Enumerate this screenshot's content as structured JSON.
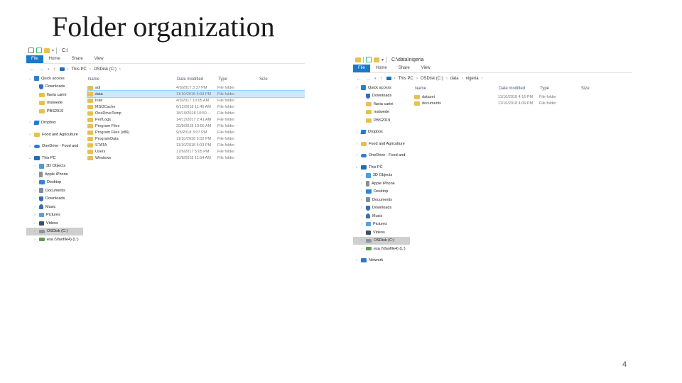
{
  "slide": {
    "title": "Folder organization",
    "page_number": "4"
  },
  "explorer1": {
    "window_title": "C:\\",
    "ribbon_tabs": [
      "File",
      "Home",
      "Share",
      "View"
    ],
    "breadcrumb": [
      "This PC",
      "OSDisk (C:)"
    ],
    "columns": [
      "Name",
      "Date modified",
      "Type",
      "Size"
    ],
    "files": [
      {
        "name": "adi",
        "date": "4/9/2017 3:37 PM",
        "type": "File folder",
        "selected": false
      },
      {
        "name": "data",
        "date": "11/10/2018 5:03 PM",
        "type": "File folder",
        "selected": true
      },
      {
        "name": "Intel",
        "date": "4/9/2017 10:05 AM",
        "type": "File folder",
        "selected": false
      },
      {
        "name": "MSOCache",
        "date": "6/12/2018 11:46 AM",
        "type": "File folder",
        "selected": false
      },
      {
        "name": "OneDriveTemp",
        "date": "18/10/2018 10:50 ...",
        "type": "File folder",
        "selected": false
      },
      {
        "name": "PerfLogs",
        "date": "14/12/2017 2:41 AM",
        "type": "File folder",
        "selected": false
      },
      {
        "name": "Program Files",
        "date": "20/9/2018 10:56 AM",
        "type": "File folder",
        "selected": false
      },
      {
        "name": "Program Files (x86)",
        "date": "9/5/2018 3:07 PM",
        "type": "File folder",
        "selected": false
      },
      {
        "name": "ProgramData",
        "date": "11/10/2018 5:02 PM",
        "type": "File folder",
        "selected": false
      },
      {
        "name": "STATA",
        "date": "11/10/2018 5:03 PM",
        "type": "File folder",
        "selected": false
      },
      {
        "name": "Users",
        "date": "17/6/2017 5:05 PM",
        "type": "File folder",
        "selected": false
      },
      {
        "name": "Windows",
        "date": "10/8/2018 11:54 AM",
        "type": "File folder",
        "selected": false
      }
    ],
    "nav": [
      {
        "label": "Quick access",
        "icon": "star-icon",
        "level": 0,
        "expander": "v",
        "gap": false,
        "selected": false
      },
      {
        "label": "Downloads",
        "icon": "download-icon",
        "level": 1,
        "expander": "",
        "gap": false,
        "selected": false
      },
      {
        "label": "flavia carini",
        "icon": "folder-icon",
        "level": 1,
        "expander": "",
        "gap": false,
        "selected": false
      },
      {
        "label": "mstwede",
        "icon": "folder-icon",
        "level": 1,
        "expander": "",
        "gap": false,
        "selected": false
      },
      {
        "label": "PBS2019",
        "icon": "folder-icon",
        "level": 1,
        "expander": "",
        "gap": false,
        "selected": false
      },
      {
        "label": "Dropbox",
        "icon": "dropbox-icon",
        "level": 0,
        "expander": ">",
        "gap": true,
        "selected": false
      },
      {
        "label": "Food and Agriculture",
        "icon": "folder-icon",
        "level": 0,
        "expander": ">",
        "gap": true,
        "selected": false
      },
      {
        "label": "OneDrive - Food and",
        "icon": "onedrive-icon",
        "level": 0,
        "expander": ">",
        "gap": true,
        "selected": false
      },
      {
        "label": "This PC",
        "icon": "pc-icon",
        "level": 0,
        "expander": "v",
        "gap": true,
        "selected": false
      },
      {
        "label": "3D Objects",
        "icon": "3d-objects-icon",
        "level": 1,
        "expander": ">",
        "gap": false,
        "selected": false
      },
      {
        "label": "Apple iPhone",
        "icon": "phone-icon",
        "level": 1,
        "expander": ">",
        "gap": false,
        "selected": false
      },
      {
        "label": "Desktop",
        "icon": "desktop-icon",
        "level": 1,
        "expander": ">",
        "gap": false,
        "selected": false
      },
      {
        "label": "Documents",
        "icon": "documents-icon",
        "level": 1,
        "expander": ">",
        "gap": false,
        "selected": false
      },
      {
        "label": "Downloads",
        "icon": "download-icon",
        "level": 1,
        "expander": ">",
        "gap": false,
        "selected": false
      },
      {
        "label": "Music",
        "icon": "music-icon",
        "level": 1,
        "expander": ">",
        "gap": false,
        "selected": false
      },
      {
        "label": "Pictures",
        "icon": "pictures-icon",
        "level": 1,
        "expander": ">",
        "gap": false,
        "selected": false
      },
      {
        "label": "Videos",
        "icon": "videos-icon",
        "level": 1,
        "expander": ">",
        "gap": false,
        "selected": false
      },
      {
        "label": "OSDisk (C:)",
        "icon": "drive-icon",
        "level": 1,
        "expander": ">",
        "gap": false,
        "selected": true
      },
      {
        "label": "esa (\\\\faofile4) (L:)",
        "icon": "usb-drive-icon",
        "level": 1,
        "expander": ">",
        "gap": false,
        "selected": false
      }
    ]
  },
  "explorer2": {
    "window_title": "C:\\data\\nigeria",
    "ribbon_tabs": [
      "File",
      "Home",
      "Share",
      "View"
    ],
    "breadcrumb": [
      "This PC",
      "OSDisk (C:)",
      "data",
      "nigeria"
    ],
    "columns": [
      "Name",
      "Date modified",
      "Type",
      "Size"
    ],
    "files": [
      {
        "name": "dataset",
        "date": "11/10/2018 4:16 PM",
        "type": "File folder",
        "selected": false
      },
      {
        "name": "documents",
        "date": "11/10/2018 4:06 PM",
        "type": "File folder",
        "selected": false
      }
    ],
    "nav": [
      {
        "label": "Quick access",
        "icon": "star-icon",
        "level": 0,
        "expander": ">",
        "gap": false,
        "selected": false
      },
      {
        "label": "Downloads",
        "icon": "download-icon",
        "level": 1,
        "expander": "",
        "gap": false,
        "selected": false
      },
      {
        "label": "flavia carini",
        "icon": "folder-icon",
        "level": 1,
        "expander": "",
        "gap": false,
        "selected": false
      },
      {
        "label": "mstwede",
        "icon": "folder-icon",
        "level": 1,
        "expander": "",
        "gap": false,
        "selected": false
      },
      {
        "label": "PBS2019",
        "icon": "folder-icon",
        "level": 1,
        "expander": "",
        "gap": false,
        "selected": false
      },
      {
        "label": "Dropbox",
        "icon": "dropbox-icon",
        "level": 0,
        "expander": ">",
        "gap": true,
        "selected": false
      },
      {
        "label": "Food and Agriculture",
        "icon": "folder-icon",
        "level": 0,
        "expander": ">",
        "gap": true,
        "selected": false
      },
      {
        "label": "OneDrive - Food and",
        "icon": "onedrive-icon",
        "level": 0,
        "expander": ">",
        "gap": true,
        "selected": false
      },
      {
        "label": "This PC",
        "icon": "pc-icon",
        "level": 0,
        "expander": "v",
        "gap": true,
        "selected": false
      },
      {
        "label": "3D Objects",
        "icon": "3d-objects-icon",
        "level": 1,
        "expander": ">",
        "gap": false,
        "selected": false
      },
      {
        "label": "Apple iPhone",
        "icon": "phone-icon",
        "level": 1,
        "expander": ">",
        "gap": false,
        "selected": false
      },
      {
        "label": "Desktop",
        "icon": "desktop-icon",
        "level": 1,
        "expander": ">",
        "gap": false,
        "selected": false
      },
      {
        "label": "Documents",
        "icon": "documents-icon",
        "level": 1,
        "expander": ">",
        "gap": false,
        "selected": false
      },
      {
        "label": "Downloads",
        "icon": "download-icon",
        "level": 1,
        "expander": ">",
        "gap": false,
        "selected": false
      },
      {
        "label": "Music",
        "icon": "music-icon",
        "level": 1,
        "expander": ">",
        "gap": false,
        "selected": false
      },
      {
        "label": "Pictures",
        "icon": "pictures-icon",
        "level": 1,
        "expander": ">",
        "gap": false,
        "selected": false
      },
      {
        "label": "Videos",
        "icon": "videos-icon",
        "level": 1,
        "expander": ">",
        "gap": false,
        "selected": false
      },
      {
        "label": "OSDisk (C:)",
        "icon": "drive-icon",
        "level": 1,
        "expander": ">",
        "gap": false,
        "selected": true
      },
      {
        "label": "esa (\\\\faofile4) (L:)",
        "icon": "usb-drive-icon",
        "level": 1,
        "expander": ">",
        "gap": false,
        "selected": false
      },
      {
        "label": "Network",
        "icon": "network-icon",
        "level": 0,
        "expander": ">",
        "gap": true,
        "selected": false
      }
    ]
  }
}
